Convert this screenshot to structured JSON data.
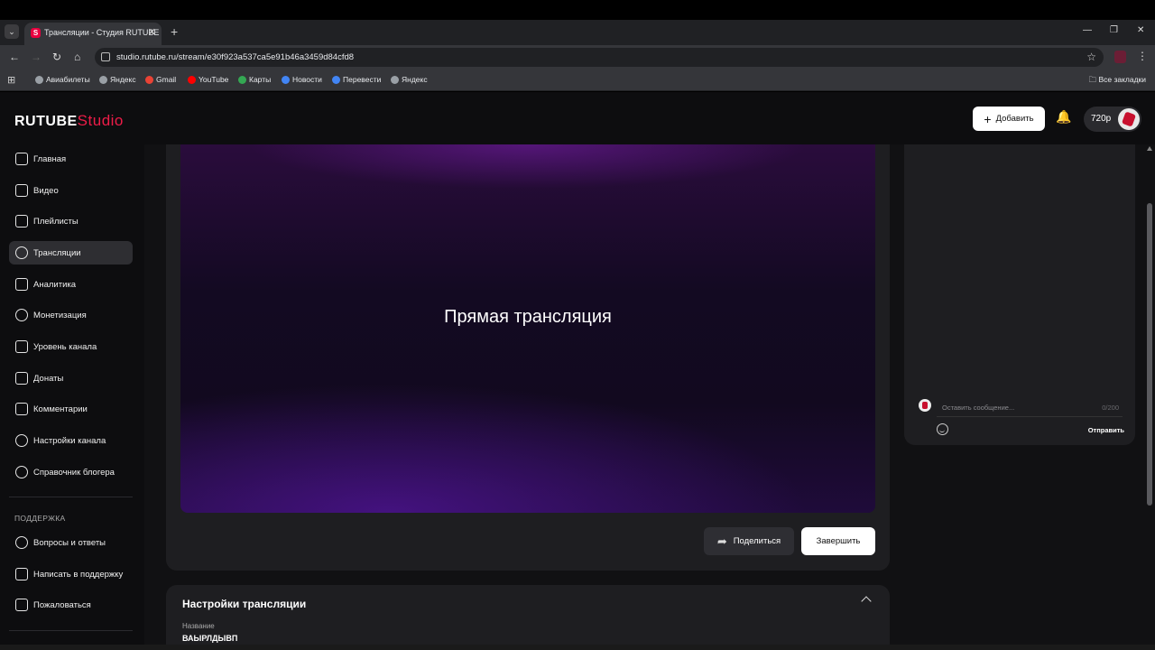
{
  "browser": {
    "tab_title": "Трансляции - Студия RUTUBE",
    "tab_favicon": "S",
    "new_tab": "+",
    "url": "studio.rutube.ru/stream/e30f923a537ca5e91b46a3459d84cfd8",
    "bookmarks": [
      "Авиабилеты",
      "Яндекс",
      "Gmail",
      "YouTube",
      "Карты",
      "Новости",
      "Перевести",
      "Яндекс"
    ],
    "bookmarks_all": "Все закладки",
    "bookmark_icon_colors": [
      "#9aa0a6",
      "#9aa0a6",
      "#ea4335",
      "#ff0000",
      "#34a853",
      "#4285f4",
      "#4285f4",
      "#9aa0a6"
    ]
  },
  "app": {
    "logo_main": "RUTUBE",
    "logo_sub": "Studio",
    "add_button": "Добавить",
    "quality": "720p",
    "sidebar": {
      "items": [
        {
          "label": "Главная",
          "icon": "home-icon"
        },
        {
          "label": "Видео",
          "icon": "video-icon"
        },
        {
          "label": "Плейлисты",
          "icon": "playlist-icon"
        },
        {
          "label": "Трансляции",
          "icon": "broadcast-icon",
          "active": true
        },
        {
          "label": "Аналитика",
          "icon": "analytics-icon"
        },
        {
          "label": "Монетизация",
          "icon": "ruble-icon"
        },
        {
          "label": "Уровень канала",
          "icon": "star-icon"
        },
        {
          "label": "Донаты",
          "icon": "wallet-icon"
        },
        {
          "label": "Комментарии",
          "icon": "comment-icon"
        },
        {
          "label": "Настройки канала",
          "icon": "gear-icon"
        },
        {
          "label": "Справочник блогера",
          "icon": "info-icon"
        }
      ],
      "support_title": "ПОДДЕРЖКА",
      "support_items": [
        {
          "label": "Вопросы и ответы",
          "icon": "question-icon"
        },
        {
          "label": "Написать в поддержку",
          "icon": "mail-icon"
        },
        {
          "label": "Пожаловаться",
          "icon": "flag-icon"
        }
      ]
    },
    "player": {
      "overlay_text": "Прямая трансляция"
    },
    "actions": {
      "share": "Поделиться",
      "finish": "Завершить"
    },
    "settings": {
      "title": "Настройки трансляции",
      "name_label": "Название",
      "name_value": "ВАЫРЛДЫВП"
    },
    "chat": {
      "placeholder": "Оставить сообщение...",
      "counter": "0/200",
      "send": "Отправить"
    },
    "colors": {
      "accent": "#ed1c48",
      "background": "#111113",
      "card": "#1e1e21"
    }
  }
}
